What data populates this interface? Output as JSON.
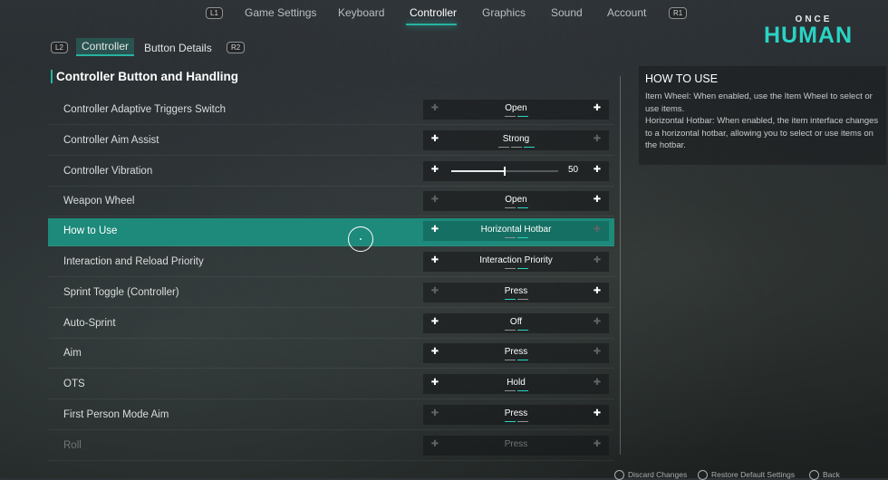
{
  "nav": {
    "left_key": "L1",
    "right_key": "R1",
    "tabs": [
      {
        "label": "Game Settings"
      },
      {
        "label": "Keyboard"
      },
      {
        "label": "Controller"
      },
      {
        "label": "Graphics"
      },
      {
        "label": "Sound"
      },
      {
        "label": "Account"
      }
    ],
    "active": "Controller"
  },
  "logo": {
    "top": "ONCE",
    "main": "HUMAN"
  },
  "subtabs": {
    "left_key": "L2",
    "right_key": "R2",
    "items": [
      {
        "label": "Controller"
      },
      {
        "label": "Button Details"
      }
    ],
    "active": "Controller"
  },
  "section_title": "Controller Button and Handling",
  "rows": [
    {
      "label": "Controller Adaptive Triggers Switch",
      "value": "Open"
    },
    {
      "label": "Controller Aim Assist",
      "value": "Strong"
    },
    {
      "label": "Controller Vibration",
      "value": "50",
      "slider_fraction": 0.5
    },
    {
      "label": "Weapon Wheel",
      "value": "Open"
    },
    {
      "label": "How to Use",
      "value": "Horizontal Hotbar"
    },
    {
      "label": "Interaction and Reload Priority",
      "value": "Interaction Priority"
    },
    {
      "label": "Sprint Toggle (Controller)",
      "value": "Press"
    },
    {
      "label": "Auto-Sprint",
      "value": "Off"
    },
    {
      "label": "Aim",
      "value": "Press"
    },
    {
      "label": "OTS",
      "value": "Hold"
    },
    {
      "label": "First Person Mode Aim",
      "value": "Press"
    },
    {
      "label": "Roll",
      "value": "Press"
    }
  ],
  "panel": {
    "title": "HOW TO USE",
    "text": "Item Wheel: When enabled, use the Item Wheel to select or use items.\nHorizontal Hotbar: When enabled, the item interface changes to a horizontal hotbar, allowing you to select or use items on the hotbar."
  },
  "footer": {
    "discard": "Discard Changes",
    "restore": "Restore Default Settings",
    "back": "Back"
  },
  "colors": {
    "accent": "#26b3a0",
    "highlight_row": "#1d8a7b"
  }
}
